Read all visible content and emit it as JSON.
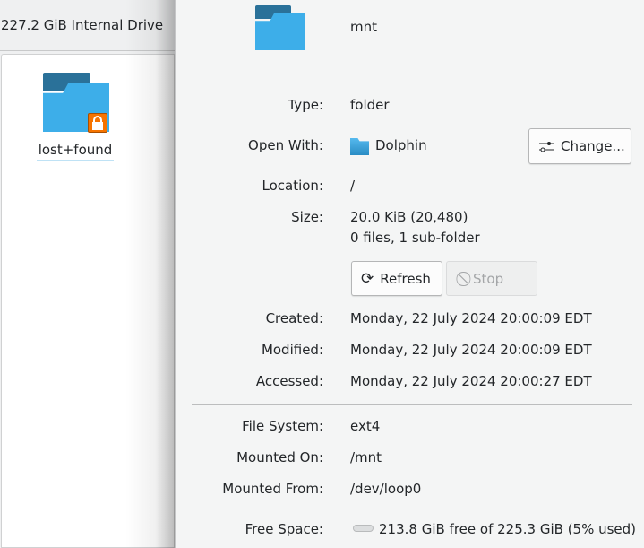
{
  "left_panel": {
    "header": "227.2 GiB Internal Drive",
    "items": [
      {
        "name": "lost+found",
        "locked": true
      }
    ]
  },
  "dialog": {
    "name": "mnt",
    "type_label": "Type:",
    "type_value": "folder",
    "open_with_label": "Open With:",
    "open_with_value": "Dolphin",
    "change_button": "Change...",
    "location_label": "Location:",
    "location_value": "/",
    "size_label": "Size:",
    "size_value": "20.0 KiB (20,480)",
    "size_detail": "0 files, 1 sub-folder",
    "refresh_button": "Refresh",
    "stop_button": "Stop",
    "created_label": "Created:",
    "created_value": "Monday, 22 July 2024 20:00:09 EDT",
    "modified_label": "Modified:",
    "modified_value": "Monday, 22 July 2024 20:00:09 EDT",
    "accessed_label": "Accessed:",
    "accessed_value": "Monday, 22 July 2024 20:00:27 EDT",
    "fs_label": "File System:",
    "fs_value": "ext4",
    "mounted_on_label": "Mounted On:",
    "mounted_on_value": "/mnt",
    "mounted_from_label": "Mounted From:",
    "mounted_from_value": "/dev/loop0",
    "free_label": "Free Space:",
    "free_value": "213.8 GiB free of 225.3 GiB (5% used)",
    "used_percent": 5
  }
}
